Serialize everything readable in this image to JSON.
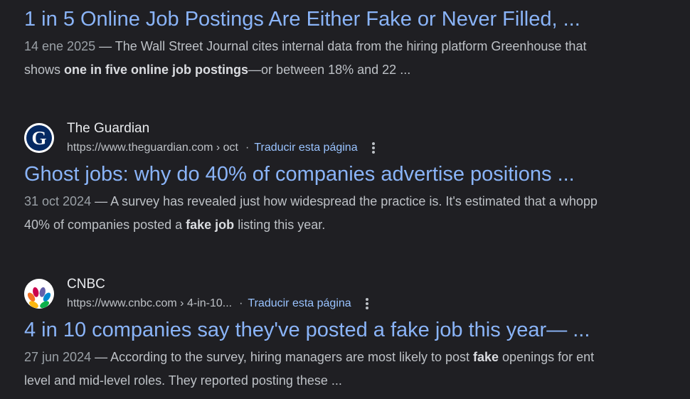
{
  "results": [
    {
      "title": "1 in 5 Online Job Postings Are Either Fake or Never Filled, ...",
      "date": "14 ene 2025",
      "separator": " — ",
      "line1_text": "The Wall Street Journal cites internal data from the hiring platform Greenhouse that",
      "line2_pre": "shows ",
      "line2_bold": "one in five online job postings",
      "line2_post": "—or between 18% and 22 ..."
    },
    {
      "site_name": "The Guardian",
      "url": "https://www.theguardian.com › oct",
      "dot": "·",
      "translate": "Traducir esta página",
      "favicon_letter": "G",
      "title": "Ghost jobs: why do 40% of companies advertise positions ...",
      "date": "31 oct 2024",
      "separator": " — ",
      "line1_text": "A survey has revealed just how widespread the practice is. It's estimated that a whopp",
      "line2_pre": "40% of companies posted a ",
      "line2_bold": "fake job",
      "line2_post": " listing this year."
    },
    {
      "site_name": "CNBC",
      "url": "https://www.cnbc.com › 4-in-10...",
      "dot": "·",
      "translate": "Traducir esta página",
      "favicon": "nbc-peacock-icon",
      "title": "4 in 10 companies say they've posted a fake job this year— ...",
      "date": "27 jun 2024",
      "separator": " — ",
      "line1_pre": "According to the survey, hiring managers are most likely to post ",
      "line1_bold": "fake",
      "line1_post": " openings for ent",
      "line2_text": "level and mid-level roles. They reported posting these ..."
    }
  ],
  "colors": {
    "background": "#1f1f23",
    "link": "#8ab4f8",
    "translate": "#99c3ff",
    "text": "#bdc1c6"
  }
}
